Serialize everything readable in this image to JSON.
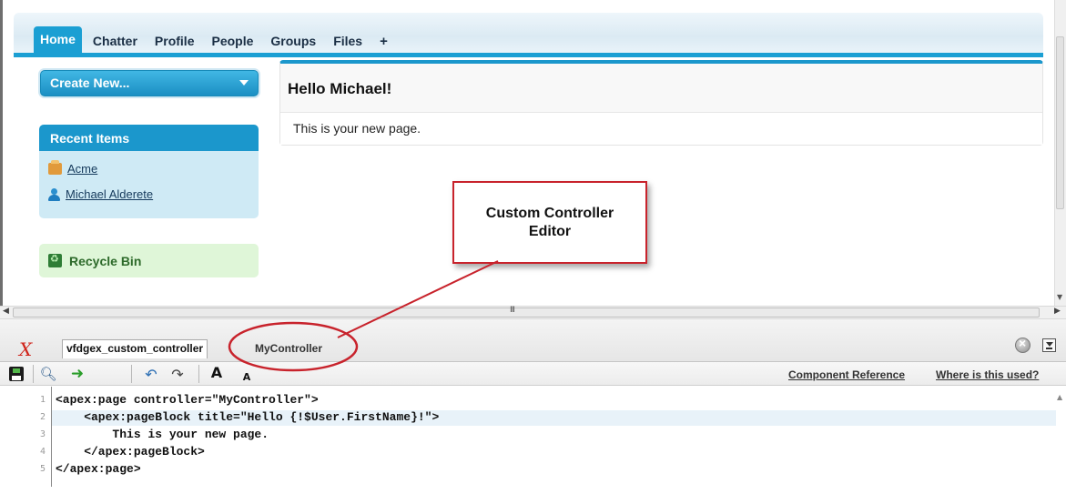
{
  "nav": {
    "tabs": [
      "Home",
      "Chatter",
      "Profile",
      "People",
      "Groups",
      "Files",
      "+"
    ]
  },
  "sidebar": {
    "create_new": "Create New...",
    "recent_items_title": "Recent Items",
    "recent_items": [
      "Acme",
      "Michael Alderete"
    ],
    "recycle_bin": "Recycle Bin"
  },
  "main": {
    "block_title": "Hello Michael!",
    "block_body": "This is your new page."
  },
  "callout": {
    "text": "Custom Controller Editor"
  },
  "dev_footer": {
    "tabs": [
      "vfdgex_custom_controller",
      "MyController"
    ],
    "links": [
      "Component Reference",
      "Where is this used?"
    ],
    "font_large": "A",
    "font_small": "A"
  },
  "editor": {
    "line_numbers": [
      "1",
      "2",
      "3",
      "4",
      "5"
    ],
    "lines": [
      "<apex:page controller=\"MyController\">",
      "    <apex:pageBlock title=\"Hello {!$User.FirstName}!\">",
      "        This is your new page.",
      "    </apex:pageBlock>",
      "</apex:page>"
    ]
  },
  "colors": {
    "accent": "#1b97cc",
    "callout_border": "#c8232c",
    "recycle_bg": "#dff6d8"
  }
}
